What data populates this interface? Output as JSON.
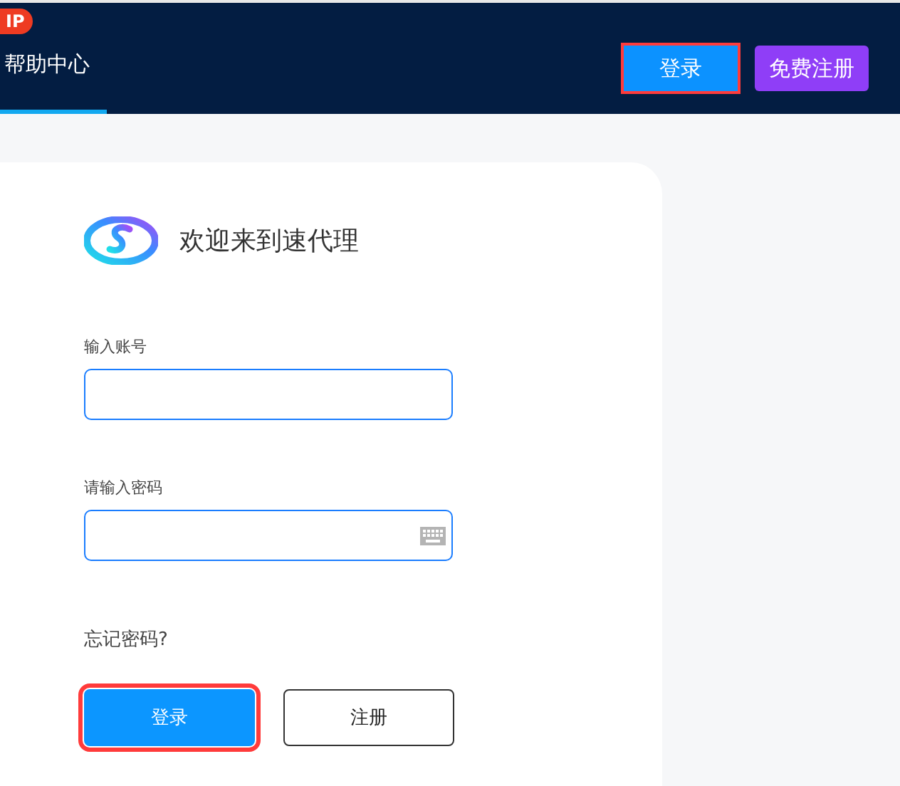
{
  "header": {
    "badge": "IP",
    "nav_items": [
      {
        "label": "帮助中心",
        "selected": true
      }
    ],
    "buttons": [
      {
        "label": "登录",
        "kind": "login",
        "highlighted": true
      },
      {
        "label": "免费注册",
        "kind": "register",
        "highlighted": false
      }
    ]
  },
  "login_card": {
    "title": "欢迎来到速代理",
    "fields": [
      {
        "label": "输入账号",
        "kind": "text"
      },
      {
        "label": "请输入密码",
        "kind": "password"
      }
    ],
    "forgot_link": "忘记密码?",
    "buttons": [
      {
        "label": "登录",
        "kind": "primary",
        "highlighted": true
      },
      {
        "label": "注册",
        "kind": "outline",
        "highlighted": false
      }
    ]
  }
}
